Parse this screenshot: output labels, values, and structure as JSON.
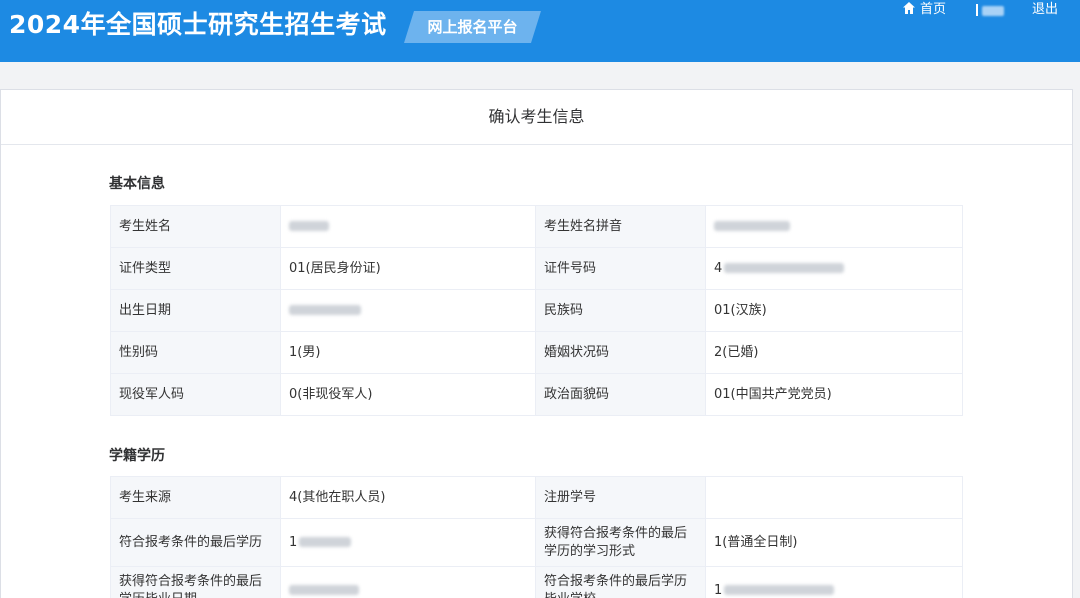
{
  "header": {
    "site_title": "2024年全国硕士研究生招生考试",
    "platform_tag": "网上报名平台",
    "nav_home": "首页",
    "nav_logout": "退出",
    "home_icon": "home-icon"
  },
  "card": {
    "title": "确认考生信息"
  },
  "basic_info": {
    "heading": "基本信息",
    "rows": [
      {
        "l1": "考生姓名",
        "v1": "",
        "l2": "考生姓名拼音",
        "v2": ""
      },
      {
        "l1": "证件类型",
        "v1": "01(居民身份证)",
        "l2": "证件号码",
        "v2": "4"
      },
      {
        "l1": "出生日期",
        "v1": "",
        "l2": "民族码",
        "v2": "01(汉族)"
      },
      {
        "l1": "性别码",
        "v1": "1(男)",
        "l2": "婚姻状况码",
        "v2": "2(已婚)"
      },
      {
        "l1": "现役军人码",
        "v1": "0(非现役军人)",
        "l2": "政治面貌码",
        "v2": "01(中国共产党党员)"
      }
    ]
  },
  "education": {
    "heading": "学籍学历",
    "rows": [
      {
        "l1": "考生来源",
        "v1": "4(其他在职人员)",
        "l2": "注册学号",
        "v2": ""
      },
      {
        "l1": "符合报考条件的最后学历",
        "v1": "1",
        "l2": "获得符合报考条件的最后学历的学习形式",
        "v2": "1(普通全日制)"
      },
      {
        "l1": "获得符合报考条件的最后学历毕业日期",
        "v1": "",
        "l2": "符合报考条件的最后学历毕业学校",
        "v2": "1"
      }
    ]
  }
}
